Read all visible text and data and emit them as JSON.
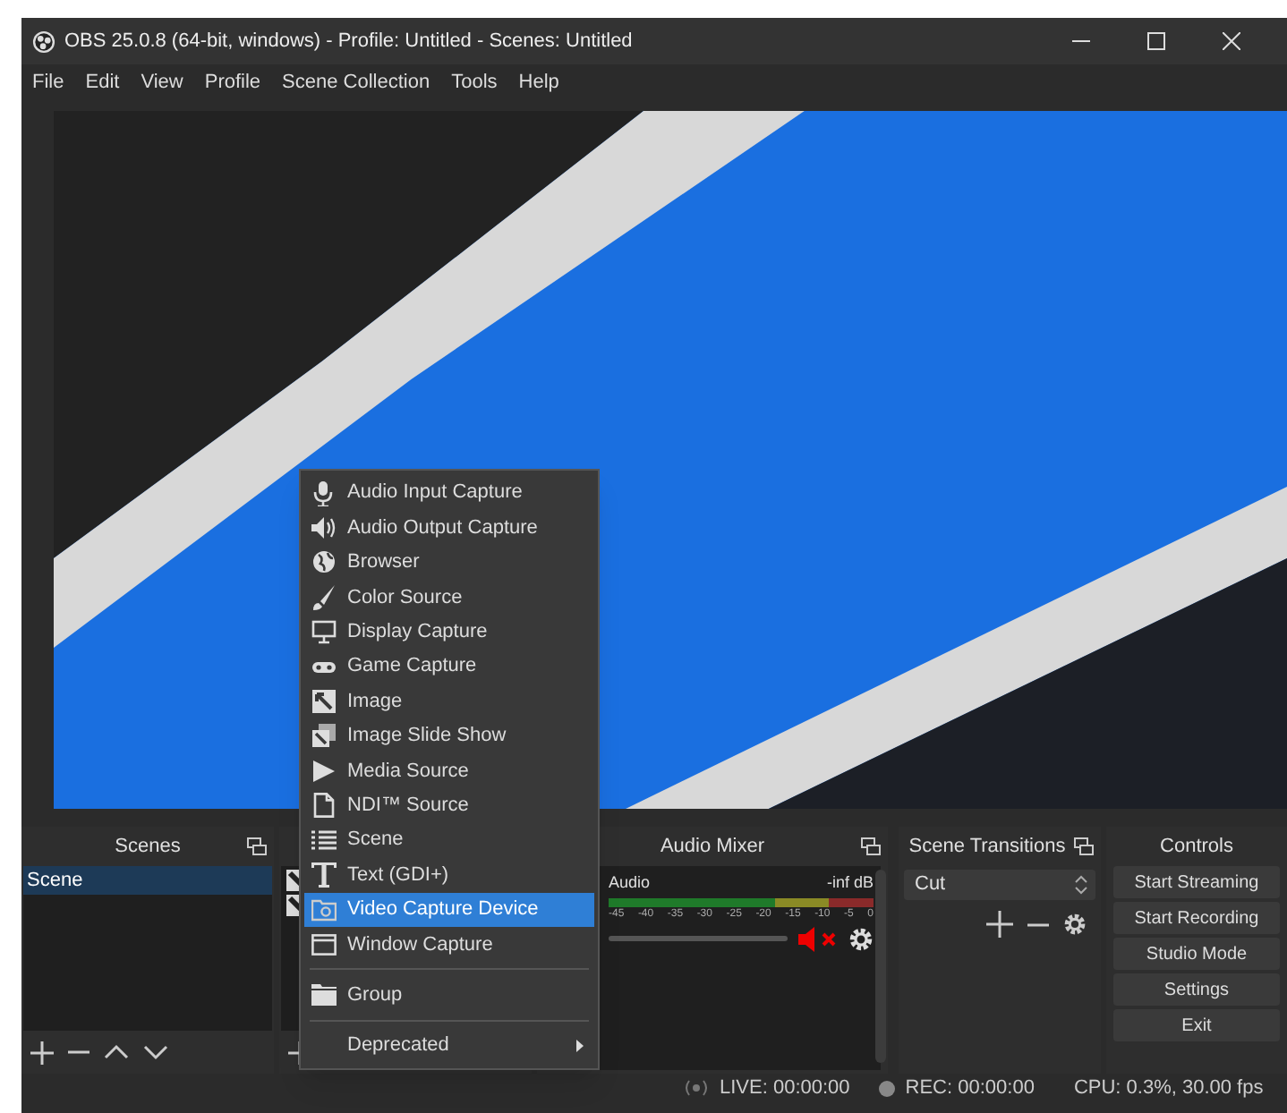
{
  "window": {
    "title": "OBS 25.0.8 (64-bit, windows) - Profile: Untitled - Scenes: Untitled"
  },
  "menu_bar": [
    "File",
    "Edit",
    "View",
    "Profile",
    "Scene Collection",
    "Tools",
    "Help"
  ],
  "docks": {
    "scenes": {
      "title": "Scenes",
      "items": [
        {
          "label": "Scene",
          "selected": true
        }
      ]
    },
    "audio_mixer": {
      "title": "Audio Mixer",
      "tracks": [
        {
          "name": "Audio",
          "reading": "-inf dB",
          "muted": true,
          "scale": [
            "-45",
            "-40",
            "-35",
            "-30",
            "-25",
            "-20",
            "-15",
            "-10",
            "-5",
            "0"
          ]
        }
      ]
    },
    "scene_transitions": {
      "title": "Scene Transitions",
      "transition": "Cut"
    },
    "controls": {
      "title": "Controls",
      "buttons": [
        "Start Streaming",
        "Start Recording",
        "Studio Mode",
        "Settings",
        "Exit"
      ]
    }
  },
  "context_menu": {
    "items": [
      {
        "kind": "item",
        "label": "Audio Input Capture",
        "selected": false
      },
      {
        "kind": "item",
        "label": "Audio Output Capture",
        "selected": false
      },
      {
        "kind": "item",
        "label": "Browser",
        "selected": false
      },
      {
        "kind": "item",
        "label": "Color Source",
        "selected": false
      },
      {
        "kind": "item",
        "label": "Display Capture",
        "selected": false
      },
      {
        "kind": "item",
        "label": "Game Capture",
        "selected": false
      },
      {
        "kind": "item",
        "label": "Image",
        "selected": false
      },
      {
        "kind": "item",
        "label": "Image Slide Show",
        "selected": false
      },
      {
        "kind": "item",
        "label": "Media Source",
        "selected": false
      },
      {
        "kind": "item",
        "label": "NDI™ Source",
        "selected": false
      },
      {
        "kind": "item",
        "label": "Scene",
        "selected": false
      },
      {
        "kind": "item",
        "label": "Text (GDI+)",
        "selected": false
      },
      {
        "kind": "item",
        "label": "Video Capture Device",
        "selected": true
      },
      {
        "kind": "item",
        "label": "Window Capture",
        "selected": false
      },
      {
        "kind": "separator"
      },
      {
        "kind": "item",
        "label": "Group",
        "selected": false
      },
      {
        "kind": "separator"
      },
      {
        "kind": "submenu",
        "label": "Deprecated",
        "selected": false
      }
    ]
  },
  "status_bar": {
    "live": "LIVE: 00:00:00",
    "rec": "REC: 00:00:00",
    "cpu": "CPU: 0.3%, 30.00 fps"
  }
}
